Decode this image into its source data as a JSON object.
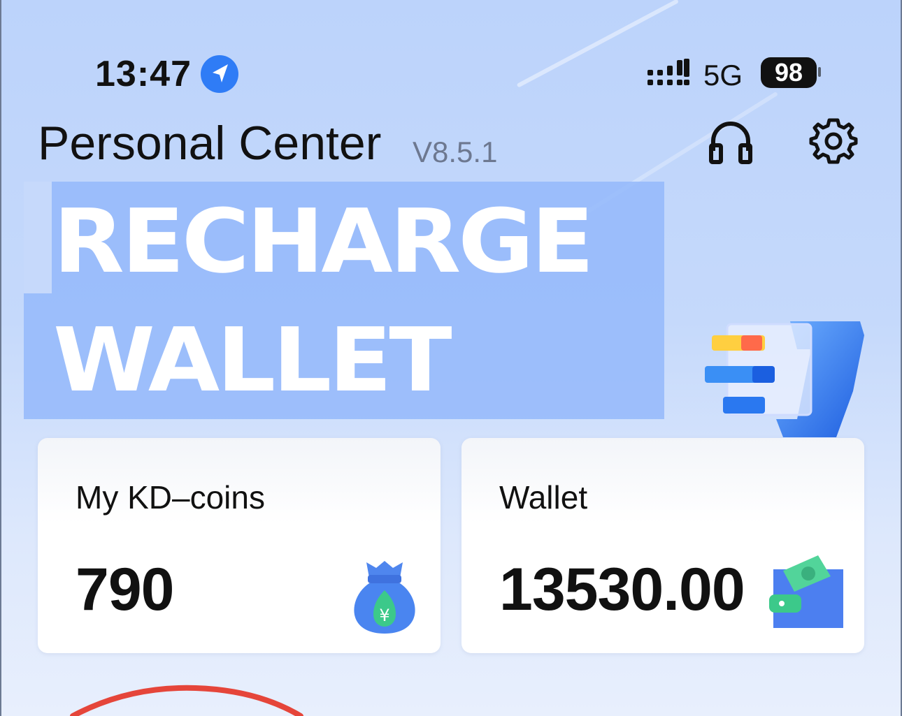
{
  "status_bar": {
    "time": "13:47",
    "network": "5G",
    "battery": "98",
    "location_icon": "location-arrow-icon",
    "signal_icon": "signal-icon"
  },
  "header": {
    "title": "Personal Center",
    "version": "V8.5.1",
    "support_icon": "headset-icon",
    "settings_icon": "gear-icon"
  },
  "banner": {
    "line1": "RECHARGE",
    "line2": "WALLET"
  },
  "cards": {
    "coins": {
      "label": "My KD–coins",
      "value": "790",
      "icon": "money-bag-icon"
    },
    "wallet": {
      "label": "Wallet",
      "value": "13530.00",
      "icon": "wallet-icon"
    }
  },
  "colors": {
    "background": "#c5d9fb",
    "banner": "#94b8fa",
    "accent_blue": "#3f7df0",
    "accent_green": "#3ec98a"
  }
}
